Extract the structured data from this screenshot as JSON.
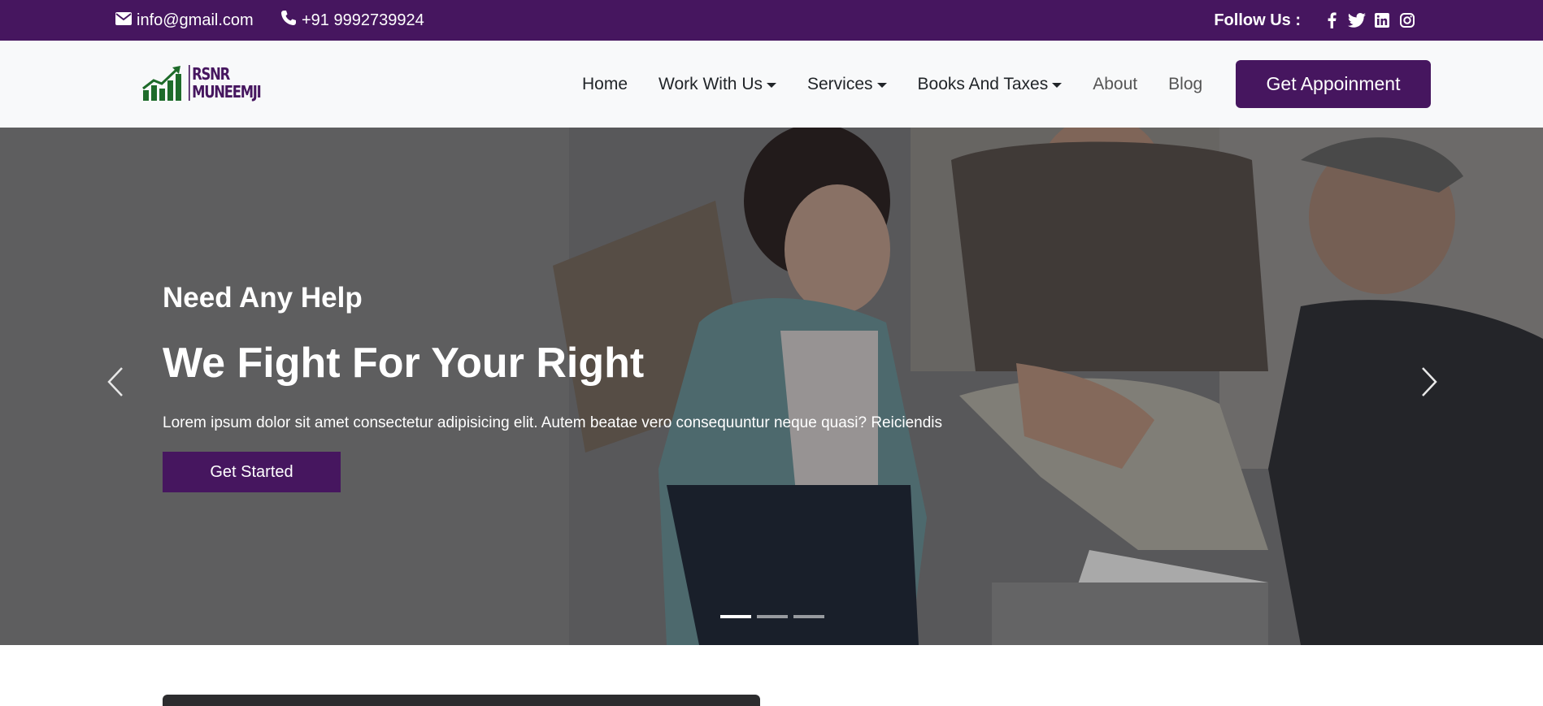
{
  "topbar": {
    "email": "info@gmail.com",
    "phone": "+91 9992739924",
    "follow_label": "Follow Us :",
    "socials": [
      "facebook-icon",
      "twitter-icon",
      "linkedin-icon",
      "instagram-icon"
    ]
  },
  "logo": {
    "line1": "RSNR",
    "line2": "MUNEEMJI"
  },
  "nav": {
    "items": [
      {
        "label": "Home",
        "dropdown": false
      },
      {
        "label": "Work With Us",
        "dropdown": true
      },
      {
        "label": "Services",
        "dropdown": true
      },
      {
        "label": "Books And Taxes",
        "dropdown": true
      },
      {
        "label": "About",
        "dropdown": false
      },
      {
        "label": "Blog",
        "dropdown": false
      }
    ],
    "cta": "Get Appoinment"
  },
  "hero": {
    "subtitle": "Need Any Help",
    "headline": "We Fight For Your Right",
    "description": "Lorem ipsum dolor sit amet consectetur adipisicing elit. Autem beatae vero consequuntur neque quasi? Reiciendis",
    "button": "Get Started",
    "slides": 3,
    "active_slide": 1
  },
  "colors": {
    "brand": "#46165f",
    "nav_bg": "#f8f9fa",
    "logo_green": "#1e6b2a"
  }
}
